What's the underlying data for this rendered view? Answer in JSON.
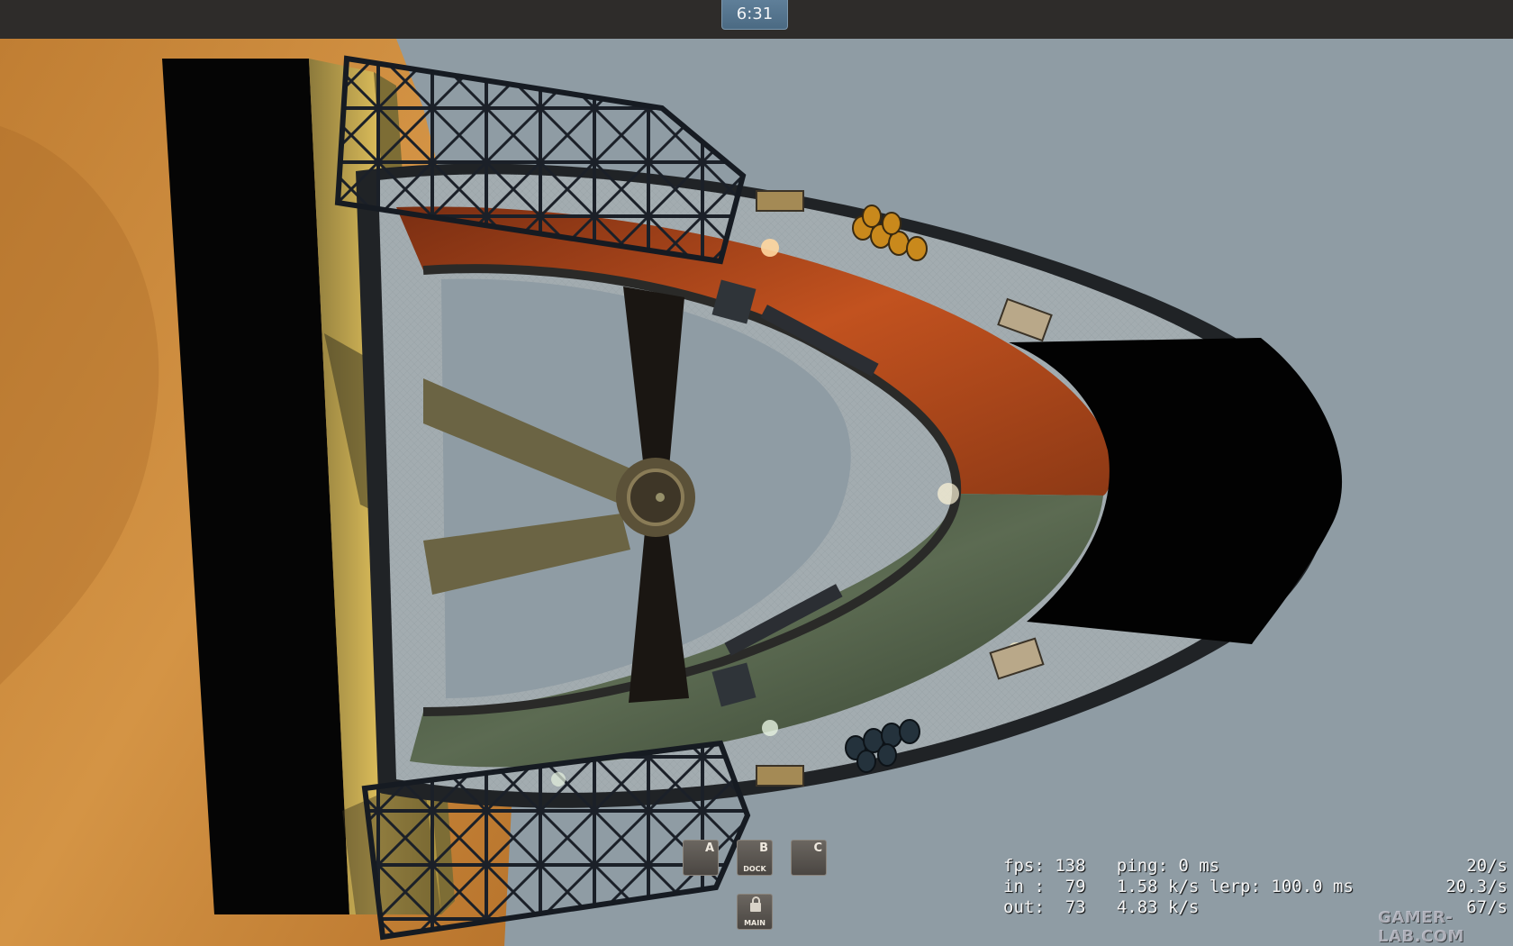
{
  "hud": {
    "round_timer": "6:31"
  },
  "control_points": [
    {
      "letter": "A",
      "name": ""
    },
    {
      "letter": "B",
      "name": "DOCK"
    },
    {
      "letter": "C",
      "name": ""
    }
  ],
  "main_point": {
    "name": "MAIN",
    "icon": "lock-icon"
  },
  "net_graph": {
    "line1": "fps: 138   ping: 0 ms",
    "line2": "in :  79   1.58 k/s lerp: 100.0 ms",
    "line3": "out:  73   4.83 k/s",
    "rate1": "20/s",
    "rate2": "20.3/s",
    "rate3": "67/s"
  },
  "watermark": "GAMER-LAB.COM",
  "colors": {
    "sky": "#8e9ba3",
    "sand": "#c9883a",
    "wall": "#d1b255",
    "ramp_orange": "#b24a1e",
    "ramp_green": "#4b5a45",
    "truss": "#1a1f26"
  }
}
